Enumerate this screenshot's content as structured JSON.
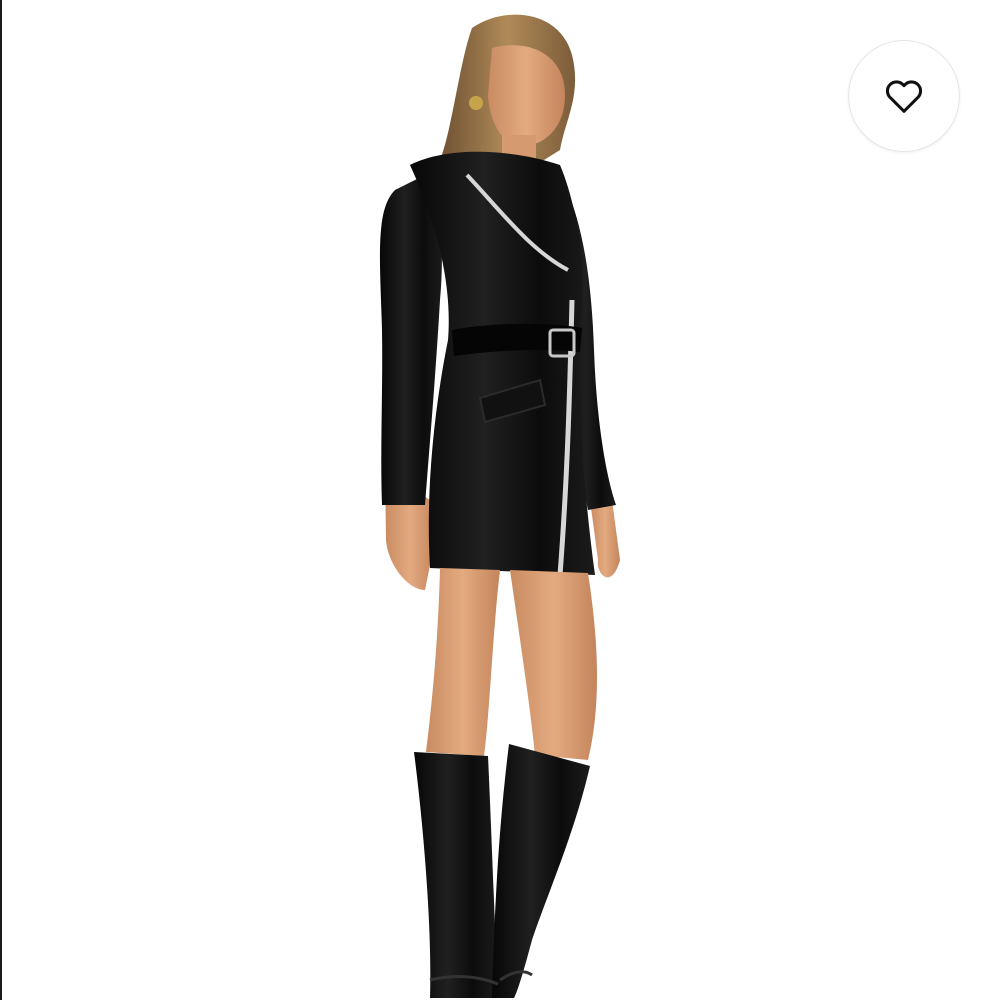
{
  "product": {
    "image_subject": "model-in-black-faux-leather-moto-dress-and-knee-high-boots"
  },
  "actions": {
    "favorite": {
      "icon": "heart-outline-icon",
      "selected": false
    }
  },
  "colors": {
    "background": "#ffffff",
    "icon_stroke": "#111111",
    "button_border": "#e6e6e6",
    "garment": "#111111",
    "skin": "#e0a47a",
    "hair": "#a9804f"
  }
}
